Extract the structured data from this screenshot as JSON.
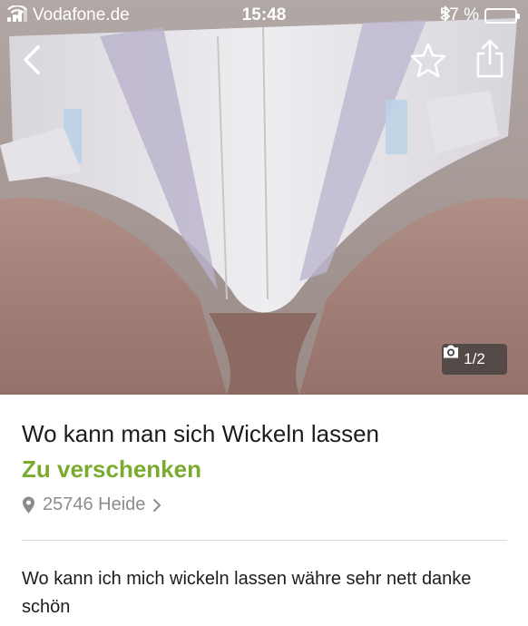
{
  "status_bar": {
    "carrier": "Vodafone.de",
    "time": "15:48",
    "battery_percent": "57 %",
    "battery_level": 0.57
  },
  "nav": {
    "back_icon": "chevron-left-icon",
    "favorite_icon": "star-outline-icon",
    "share_icon": "share-icon"
  },
  "photo": {
    "counter": "1/2",
    "counter_icon": "camera-icon"
  },
  "listing": {
    "title": "Wo kann man sich Wickeln lassen",
    "price": "Zu verschenken",
    "location": "25746 Heide",
    "description": "Wo kann ich mich wickeln lassen währe sehr nett danke schön"
  },
  "colors": {
    "price_green": "#7aab2e",
    "text_dark": "#1c1c1c",
    "text_muted": "#8c8c8c",
    "divider": "#dcdcdc"
  }
}
